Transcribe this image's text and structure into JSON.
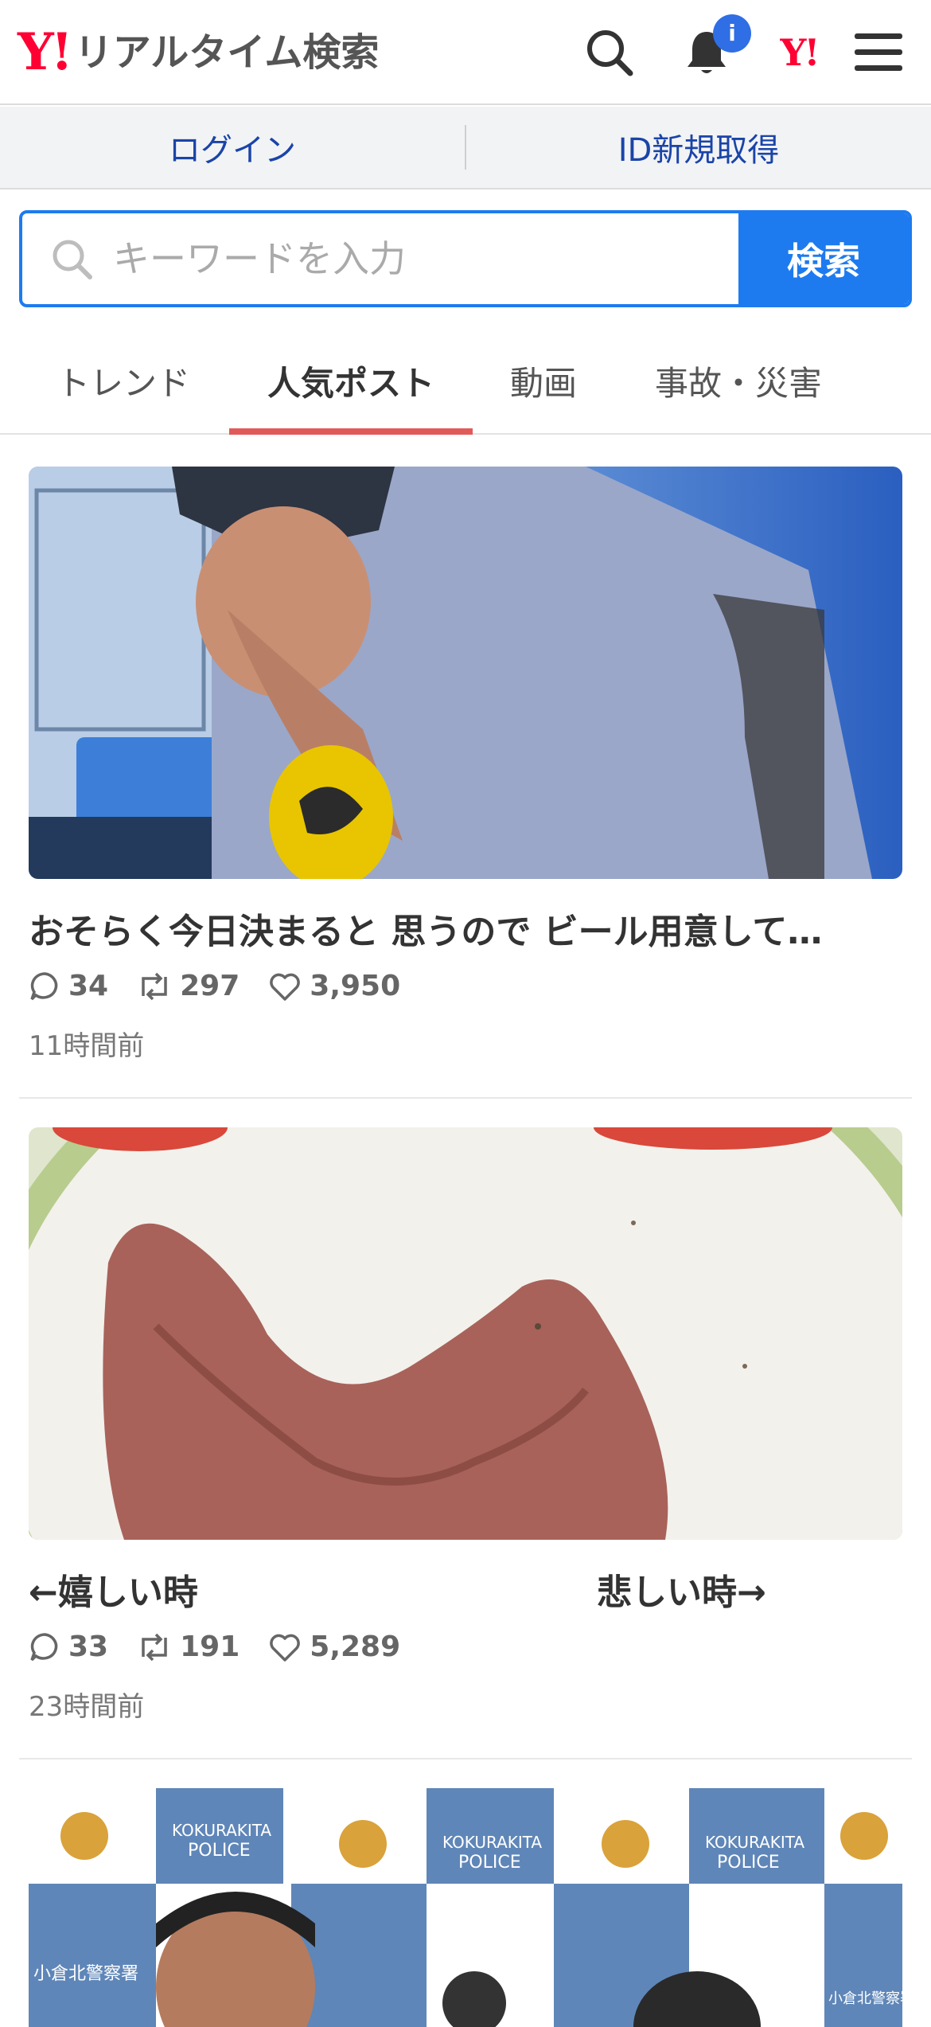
{
  "header": {
    "logo_y": "Y!",
    "logo_text": "リアルタイム検索",
    "notification_badge": "i",
    "yahoo_small": "Y!",
    "icons": [
      "search-icon",
      "bell-icon",
      "yahoo-icon",
      "menu-icon"
    ],
    "brand_color": "#ff0033"
  },
  "login_bar": {
    "login_label": "ログイン",
    "register_label": "ID新規取得"
  },
  "search": {
    "placeholder": "キーワードを入力",
    "value": "",
    "button_label": "検索",
    "accent_color": "#1e7bef"
  },
  "tabs": [
    {
      "label": "トレンド",
      "active": false
    },
    {
      "label": "人気ポスト",
      "active": true
    },
    {
      "label": "動画",
      "active": false
    },
    {
      "label": "事故・災害",
      "active": false
    }
  ],
  "posts": [
    {
      "title": "おそらく今日決まると 思うので ビール用意して…",
      "replies": "34",
      "reposts": "297",
      "likes": "3,950",
      "time": "11時間前"
    },
    {
      "title_left": "←嬉しい時",
      "title_right": "悲しい時→",
      "replies": "33",
      "reposts": "191",
      "likes": "5,289",
      "time": "23時間前"
    },
    {
      "image_text": [
        "KOKURAKITA",
        "POLICE",
        "小倉北警察署"
      ]
    }
  ]
}
